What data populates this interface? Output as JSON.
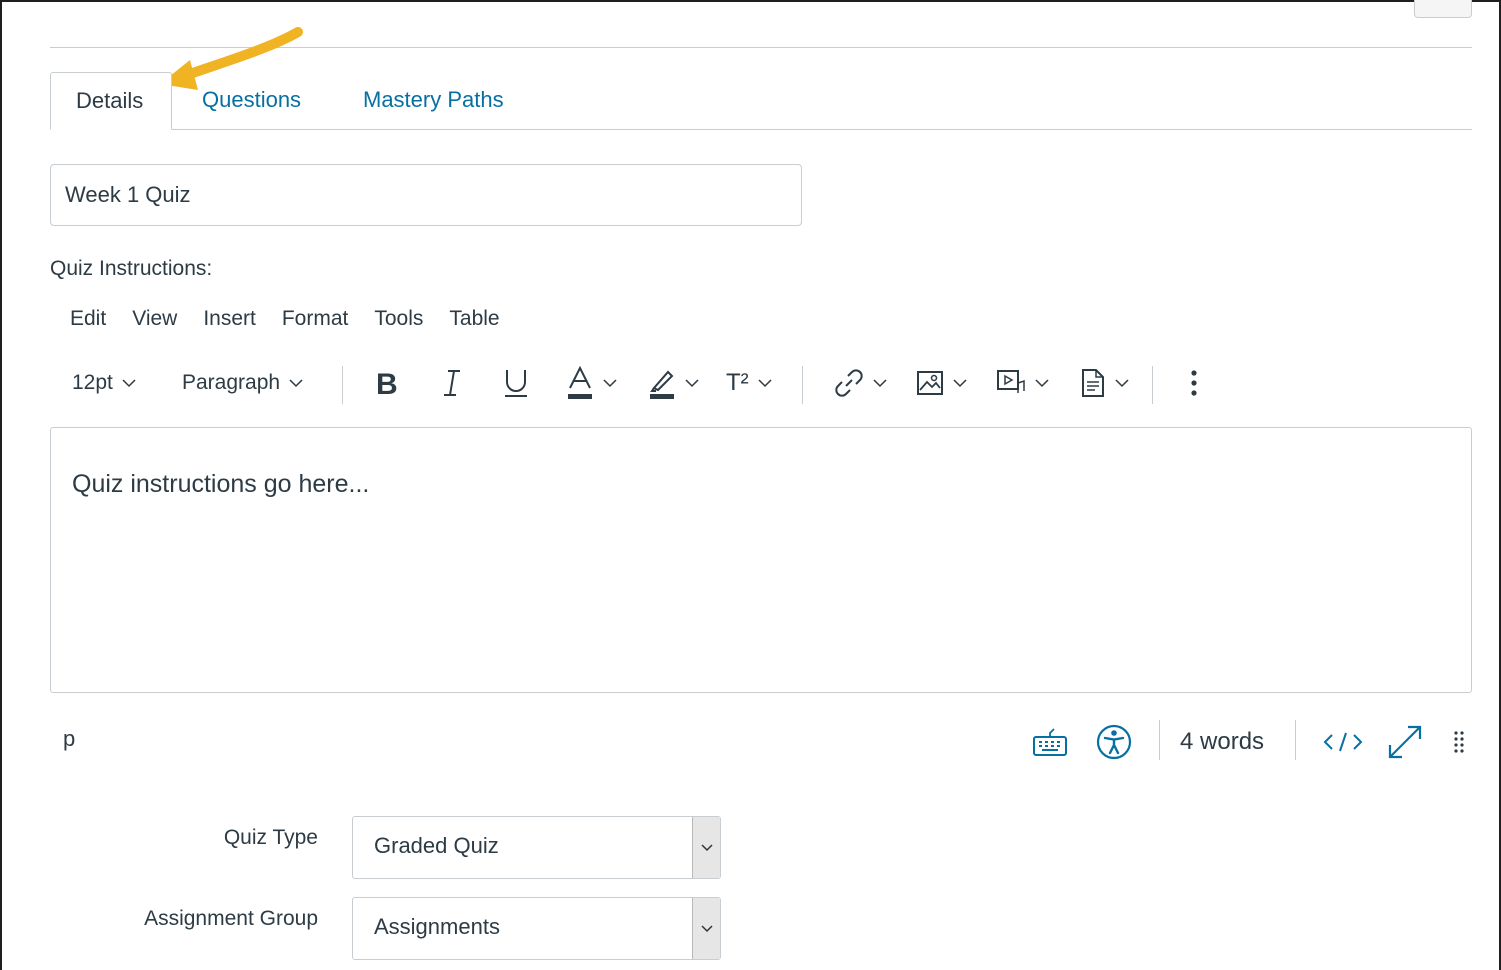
{
  "tabs": [
    {
      "label": "Details",
      "active": true
    },
    {
      "label": "Questions",
      "active": false
    },
    {
      "label": "Mastery Paths",
      "active": false
    }
  ],
  "quiz_title": {
    "value": "Week 1 Quiz"
  },
  "instructions_label": "Quiz Instructions:",
  "editor": {
    "menu": [
      "Edit",
      "View",
      "Insert",
      "Format",
      "Tools",
      "Table"
    ],
    "font_size": "12pt",
    "block_format": "Paragraph",
    "superscript_label": "T²",
    "content": "Quiz instructions go here...",
    "path": "p",
    "word_count": "4 words"
  },
  "quiz_type": {
    "label": "Quiz Type",
    "value": "Graded Quiz"
  },
  "assignment_group": {
    "label": "Assignment Group",
    "value": "Assignments"
  },
  "colors": {
    "link": "#0770a3",
    "text": "#2d3b45",
    "border": "#c7cdd1",
    "annotation": "#f0b323"
  },
  "icons": [
    "bold-icon",
    "italic-icon",
    "underline-icon",
    "text-color-icon",
    "highlight-icon",
    "superscript-icon",
    "link-icon",
    "image-icon",
    "media-icon",
    "document-icon",
    "more-icon",
    "keyboard-icon",
    "accessibility-icon",
    "html-editor-icon",
    "fullscreen-icon",
    "resize-handle-icon"
  ]
}
